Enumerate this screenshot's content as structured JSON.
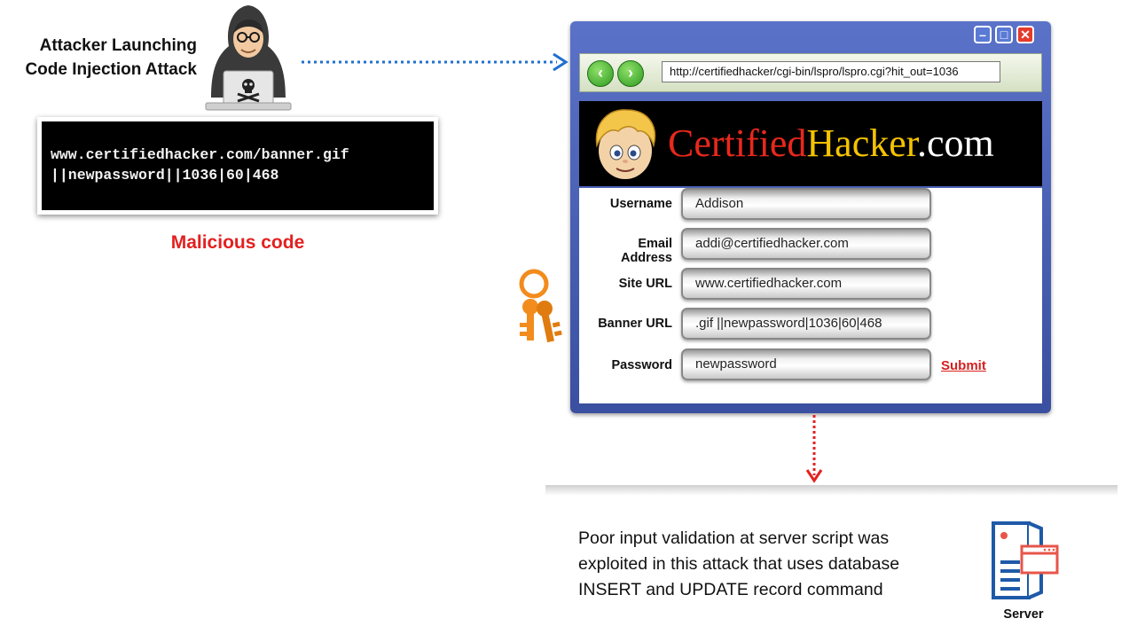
{
  "attacker": {
    "label_line1": "Attacker Launching",
    "label_line2": "Code Injection Attack"
  },
  "malicious_code": {
    "line1": "www.certifiedhacker.com/banner.gif",
    "line2": "||newpassword||1036|60|468",
    "caption": "Malicious code"
  },
  "browser": {
    "url": "http://certifiedhacker/cgi-bin/lspro/lspro.cgi?hit_out=1036",
    "site_name_part1": "Certified",
    "site_name_part2": "Hacker",
    "site_name_part3": ".com",
    "form": {
      "fields": [
        {
          "label": "Username",
          "value": "Addison"
        },
        {
          "label": "Email Address",
          "value": "addi@certifiedhacker.com"
        },
        {
          "label": "Site URL",
          "value": "www.certifiedhacker.com"
        },
        {
          "label": "Banner URL",
          "value": ".gif ||newpassword|1036|60|468"
        },
        {
          "label": "Password",
          "value": "newpassword"
        }
      ],
      "submit_label": "Submit"
    }
  },
  "server": {
    "text_line1": "Poor input validation at server script was",
    "text_line2": "exploited in this attack that uses database",
    "text_line3": "INSERT and UPDATE record command",
    "label": "Server"
  },
  "colors": {
    "accent_red": "#e32020",
    "arrow_blue": "#1f6fd1",
    "key_orange": "#f28c1c",
    "window_blue": "#4a60b8"
  }
}
